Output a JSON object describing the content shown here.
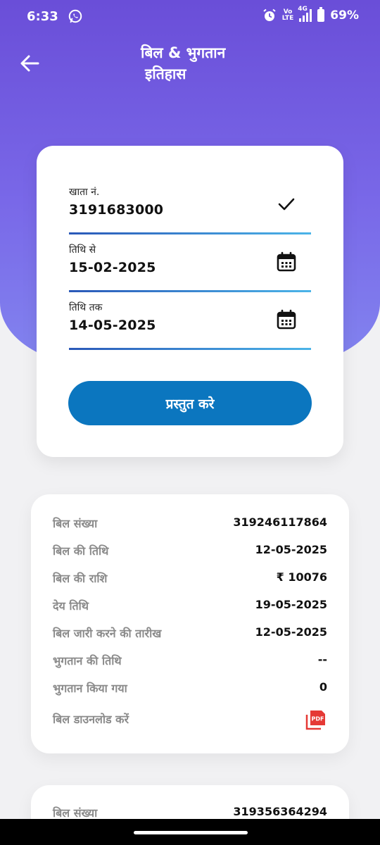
{
  "status": {
    "time": "6:33",
    "volte_top": "Vo",
    "volte_bottom": "LTE",
    "network": "4G",
    "battery": "69%"
  },
  "header": {
    "title_line1": "बिल & भुगतान",
    "title_line2": "इतिहास"
  },
  "form": {
    "account_label": "खाता नं.",
    "account_value": "3191683000",
    "from_label": "तिथि से",
    "from_value": "15-02-2025",
    "to_label": "तिथि तक",
    "to_value": "14-05-2025",
    "submit_label": "प्रस्तुत करे"
  },
  "bills": [
    {
      "rows": [
        {
          "label": "बिल संख्या",
          "value": "319246117864"
        },
        {
          "label": "बिल की तिथि",
          "value": "12-05-2025"
        },
        {
          "label": "बिल की राशि",
          "value": "₹ 10076"
        },
        {
          "label": "देय तिथि",
          "value": "19-05-2025"
        },
        {
          "label": "बिल जारी करने की तारीख",
          "value": "12-05-2025"
        },
        {
          "label": "भुगतान की तिथि",
          "value": "--"
        },
        {
          "label": "भुगतान किया गया",
          "value": "0"
        }
      ],
      "download_label": "बिल डाउनलोड करें",
      "pdf_text": "PDF"
    },
    {
      "rows": [
        {
          "label": "बिल संख्या",
          "value": "319356364294"
        }
      ]
    }
  ],
  "colors": {
    "header_top": "#6a4ed8",
    "header_bottom": "#8284ef",
    "button": "#0b76bf",
    "pdf_red": "#e53935"
  }
}
